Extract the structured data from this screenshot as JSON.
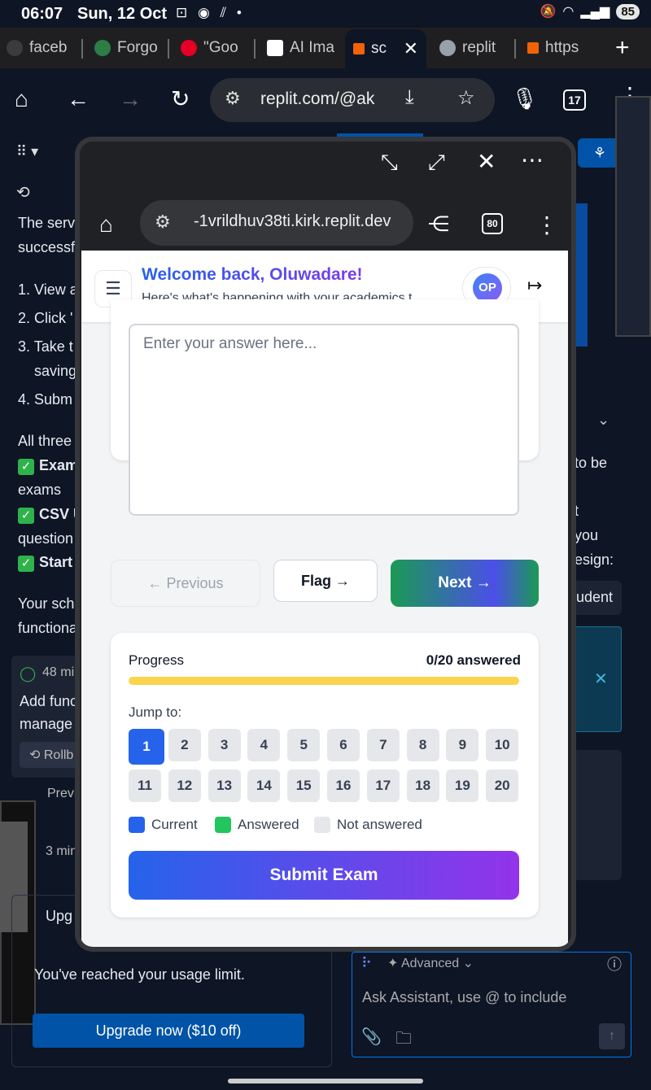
{
  "status_bar": {
    "time": "06:07",
    "date": "Sun, 12 Oct",
    "battery": "85"
  },
  "tabs": [
    {
      "label": "faceb",
      "color": "#3b3b3b"
    },
    {
      "label": "Forgo",
      "color": "#2d7d46"
    },
    {
      "label": "\"Goo",
      "color": "#e60023"
    },
    {
      "label": "AI Ima",
      "color": "#ffffff"
    },
    {
      "label": "sc",
      "color": "#f26207"
    },
    {
      "label": "replit",
      "color": "#9aa0a6"
    },
    {
      "label": "https",
      "color": "#f26207"
    }
  ],
  "browser": {
    "url": "replit.com/@ak",
    "tab_count": "17"
  },
  "background": {
    "lines": [
      "The serv",
      "successf",
      "1. View a",
      "2. Click '",
      "3. Take t",
      "saving",
      "4. Subm",
      "All three",
      "Exam",
      "exams",
      "CSV U",
      "question",
      "Start",
      "Your sch",
      "functiona"
    ],
    "right_lines": [
      "to be",
      "t",
      "you",
      "esign:",
      "udent"
    ],
    "checkpoint_time": "48 mi",
    "checkpoint_title": "Add func",
    "checkpoint_sub": "manage",
    "rollback": "Rollb",
    "preview": "Previ",
    "time2": "3 min",
    "upgrade_title": "Upg",
    "usage_limit": "You've reached your usage limit.",
    "upgrade_btn": "Upgrade now ($10 off)",
    "assistant_mode": "Advanced",
    "assistant_placeholder": "Ask Assistant, use @ to include"
  },
  "popup": {
    "url": "-1vrildhuv38ti.kirk.replit.dev",
    "badge": "80"
  },
  "app": {
    "welcome": "Welcome back, Oluwadare!",
    "subtitle": "Here's what's happening with your academics t...",
    "avatar": "OP",
    "answer_placeholder": "Enter your answer here...",
    "prev": "← Previous",
    "flag": "Flag →",
    "next": "Next →",
    "progress_label": "Progress",
    "progress_count": "0/20 answered",
    "progress_fraction": 0,
    "jump_label": "Jump to:",
    "questions": [
      "1",
      "2",
      "3",
      "4",
      "5",
      "6",
      "7",
      "8",
      "9",
      "10",
      "11",
      "12",
      "13",
      "14",
      "15",
      "16",
      "17",
      "18",
      "19",
      "20"
    ],
    "current_question": "1",
    "legend": {
      "current": "Current",
      "answered": "Answered",
      "not_answered": "Not answered"
    },
    "submit": "Submit Exam",
    "colors": {
      "current": "#2563eb",
      "answered": "#22c55e",
      "not_answered": "#e5e7eb",
      "progress_bar": "#fbd34d",
      "accent_start": "#1a9a54",
      "accent_end": "#4b4fe8"
    }
  }
}
